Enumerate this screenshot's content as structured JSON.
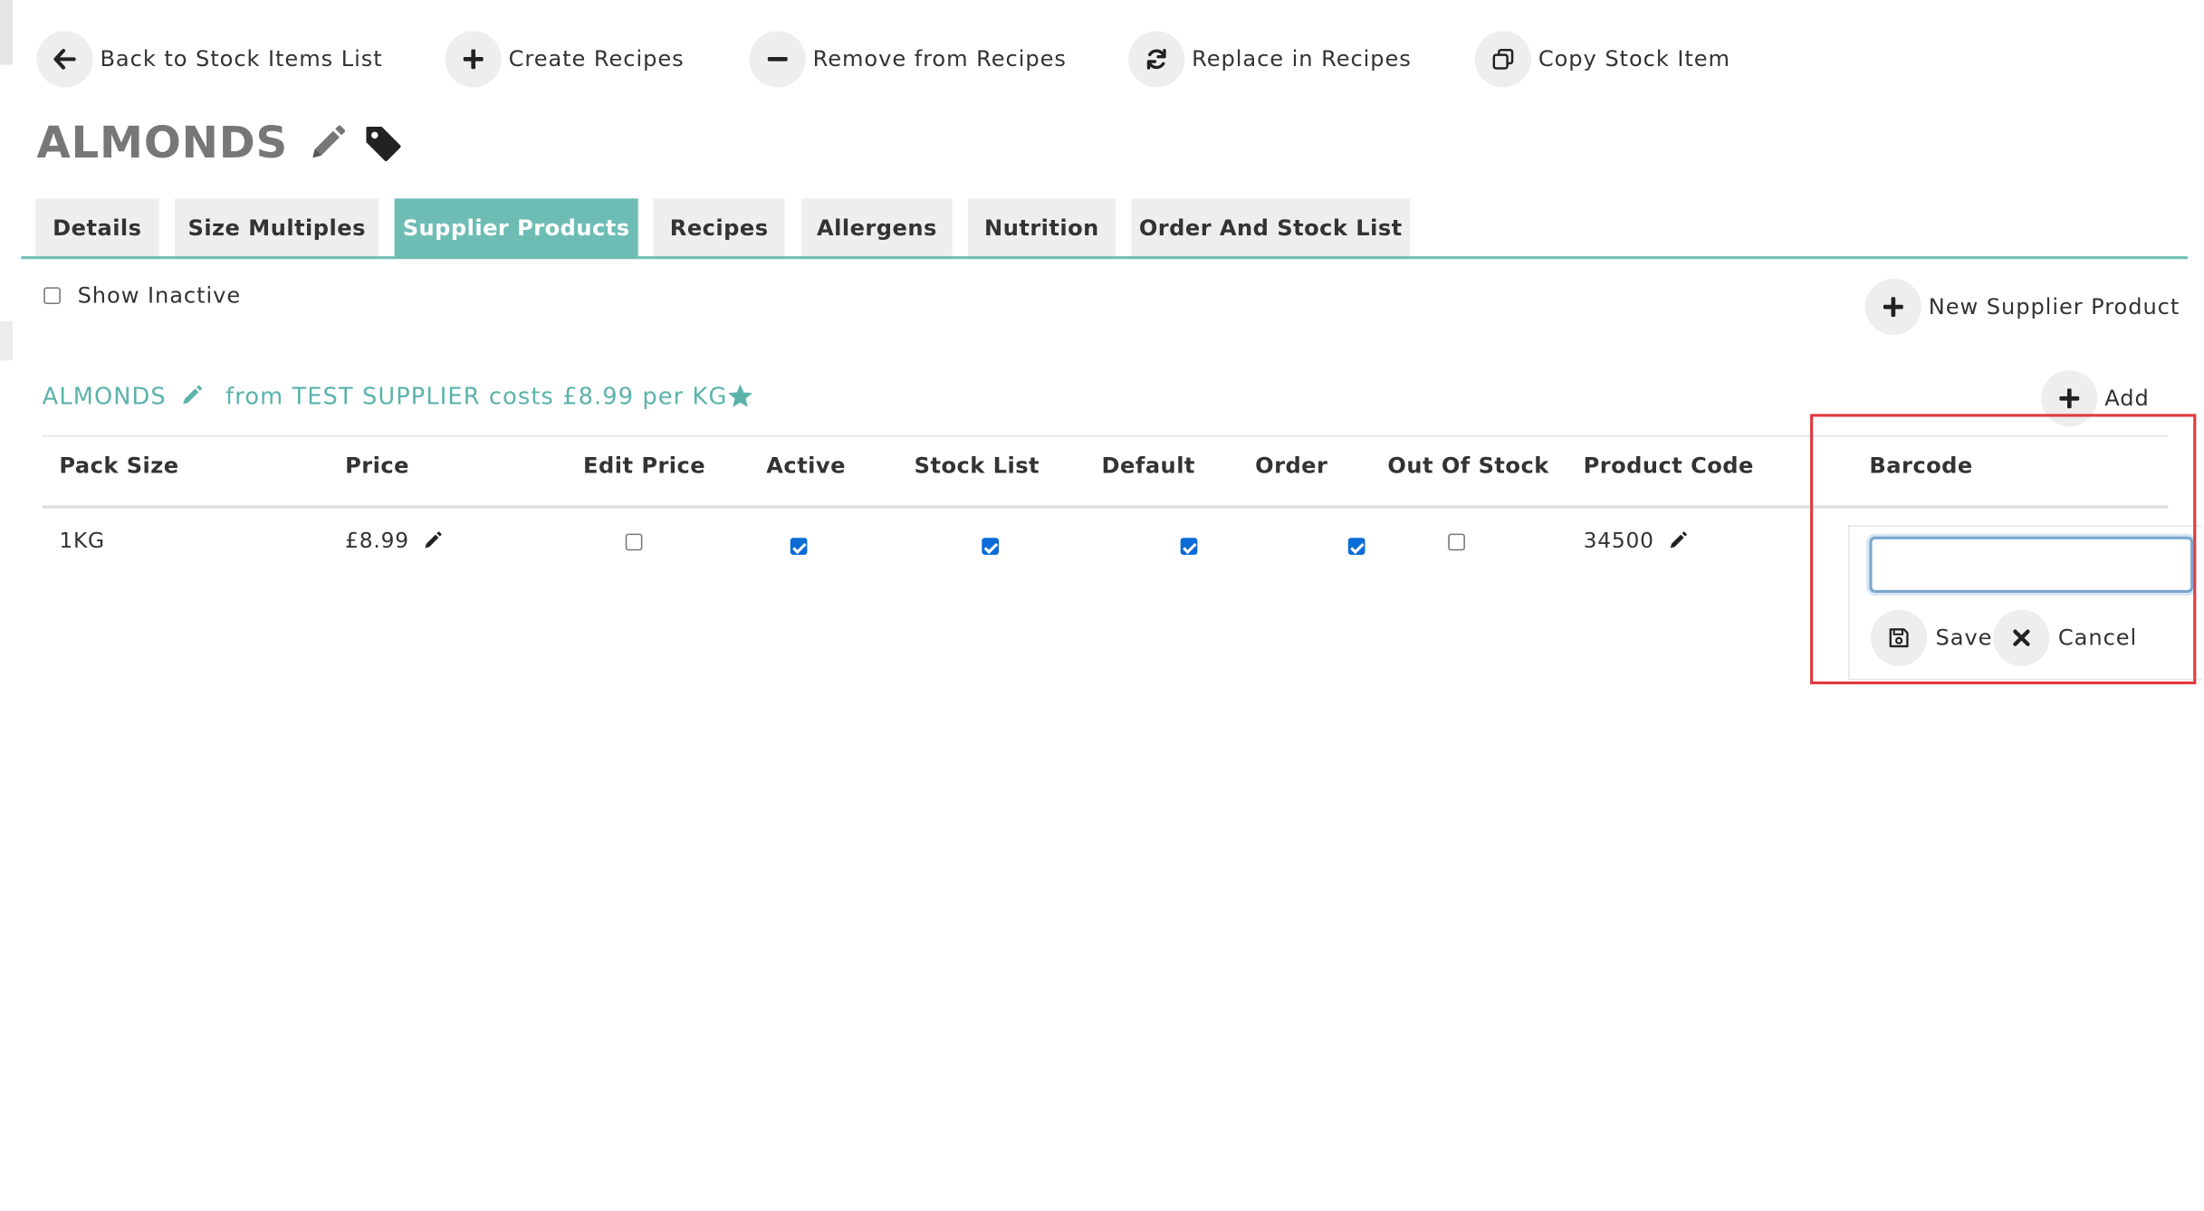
{
  "toolbar": {
    "back_label": "Back to Stock Items List",
    "create_label": "Create Recipes",
    "remove_label": "Remove from Recipes",
    "replace_label": "Replace in Recipes",
    "copy_label": "Copy Stock Item"
  },
  "item": {
    "title": "ALMONDS"
  },
  "tabs": [
    {
      "label": "Details"
    },
    {
      "label": "Size Multiples"
    },
    {
      "label": "Supplier Products"
    },
    {
      "label": "Recipes"
    },
    {
      "label": "Allergens"
    },
    {
      "label": "Nutrition"
    },
    {
      "label": "Order And Stock List"
    }
  ],
  "active_tab": "Supplier Products",
  "filters": {
    "show_inactive_label": "Show Inactive",
    "show_inactive_checked": false
  },
  "new_supplier_product_label": "New Supplier Product",
  "supplier_product": {
    "name": "ALMONDS",
    "summary": "from TEST SUPPLIER costs £8.99 per KG",
    "add_label": "Add"
  },
  "table": {
    "headers": [
      "Pack Size",
      "Price",
      "Edit Price",
      "Active",
      "Stock List",
      "Default",
      "Order",
      "Out Of Stock",
      "Product Code",
      "Barcode"
    ],
    "rows": [
      {
        "pack_size": "1KG",
        "price": "£8.99",
        "edit_price": false,
        "active": true,
        "stock_list": true,
        "default": true,
        "order": true,
        "out_of_stock": false,
        "product_code": "34500",
        "barcode": ""
      }
    ]
  },
  "barcode_editor": {
    "value": "",
    "save_label": "Save",
    "cancel_label": "Cancel"
  },
  "colors": {
    "accent": "#6ebdb5",
    "accent_text": "#5bb3ab",
    "highlight": "#e0393e",
    "tab_bg": "#eeeeee",
    "checkbox": "#0b6bd8"
  },
  "icons": {
    "back": "arrow-left-icon",
    "create": "plus-icon",
    "remove": "minus-icon",
    "replace": "refresh-icon",
    "copy": "copy-icon",
    "edit": "pencil-icon",
    "tag": "tag-icon",
    "star": "star-icon",
    "save": "floppy-disk-icon",
    "cancel": "close-icon"
  }
}
